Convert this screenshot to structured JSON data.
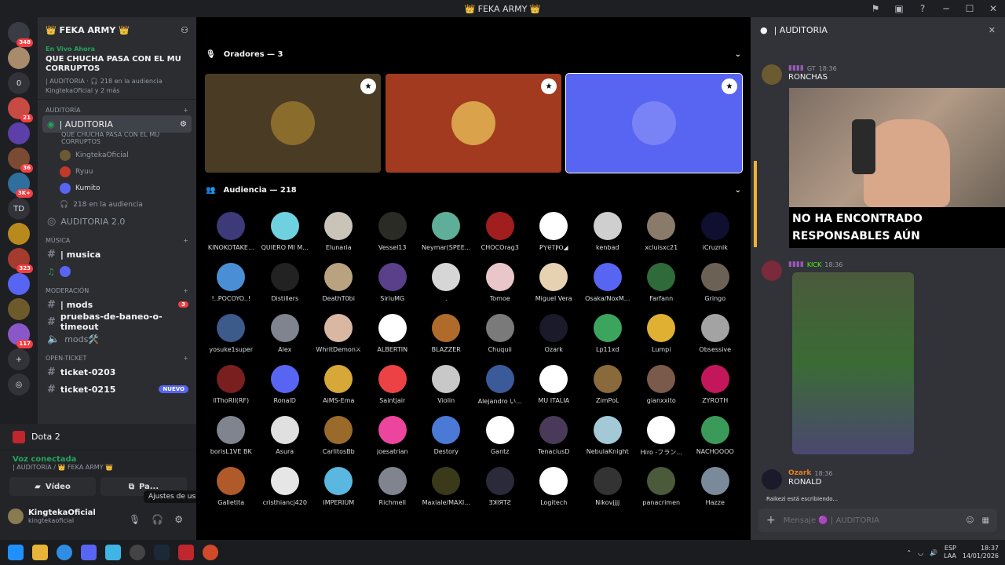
{
  "window": {
    "title": "👑 FEKA ARMY 👑"
  },
  "servers": [
    {
      "badge": "348",
      "color": "#3a3c43"
    },
    {
      "badge": "",
      "color": "#a88b6a"
    },
    {
      "badge": "",
      "color": "#313338",
      "text": "0"
    },
    {
      "badge": "21",
      "color": "#c74a43"
    },
    {
      "badge": "",
      "color": "#5c3fa8"
    },
    {
      "badge": "36",
      "color": "#7a4a33"
    },
    {
      "badge": "3K+",
      "color": "#2e6f9e"
    },
    {
      "badge": "",
      "color": "#313338",
      "text": "TD"
    },
    {
      "badge": "",
      "color": "#b88a1e"
    },
    {
      "badge": "323",
      "color": "#a33b2e"
    },
    {
      "badge": "",
      "color": "#5865f2"
    },
    {
      "badge": "",
      "color": "#6d5a2a"
    },
    {
      "badge": "117",
      "color": "#8a57c8"
    }
  ],
  "guild": {
    "name": "👑 FEKA ARMY 👑"
  },
  "live": {
    "tag": "En Vivo Ahora",
    "title": "QUE CHUCHA PASA CON EL MU CORRUPTOS",
    "meta1": "| AUDITORIA · 🎧 218 en la audiencia",
    "meta2": "KingtekaOficial y 2 más"
  },
  "categories": {
    "auditoria": "AUDITORÍA",
    "musica": "MÚSICA",
    "moderacion": "MODERACIÓN",
    "open_ticket": "OPEN-TICKET"
  },
  "channels": {
    "auditoria_active": "| AUDITORIA",
    "auditoria_sub": "QUE CHUCHA PASA CON EL MU CORRUPTOS",
    "members": [
      "KingtekaOficial",
      "Ryuu",
      "Kumito"
    ],
    "audience": "218 en la audiencia",
    "auditoria2": "AUDITORIA 2.0",
    "musica": "| musica",
    "mods": "| mods",
    "mods_badge": "3",
    "pruebas": "pruebas-de-baneo-o-timeout",
    "mods_voice": "mods🛠️",
    "ticket1": "ticket-0203",
    "ticket2": "ticket-0215",
    "nuevo": "NUEVO"
  },
  "activity": {
    "game": "Dota 2"
  },
  "voice": {
    "status": "Voz conectada",
    "location": "| AUDITORIA / 👑 FEKA ARMY 👑",
    "video_label": "Vídeo",
    "screen_label": "Pa..."
  },
  "tooltip": "Ajustes de usuario",
  "user": {
    "name": "KingtekaOficial",
    "tag": "kingtekaoficial"
  },
  "stage": {
    "speakers_label": "Oradores — 3",
    "audience_label": "Audiencia — 218"
  },
  "speakers": [
    {
      "bg": "#4a3c24",
      "avatar": "#8a6d2c"
    },
    {
      "bg": "#a13a1f",
      "avatar": "#d9a24b"
    },
    {
      "bg": "#5865f2",
      "avatar": "#7983f5"
    }
  ],
  "audience": [
    {
      "name": "KINOKOTAKE...",
      "color": "#3d3a7a"
    },
    {
      "name": "QUIERO MI M...",
      "color": "#6fd1e0"
    },
    {
      "name": "Elunaria",
      "color": "#c9c3b8"
    },
    {
      "name": "Vessel13",
      "color": "#2b2b26"
    },
    {
      "name": "Neymar(SPEE...",
      "color": "#5fae9a"
    },
    {
      "name": "CHOCOrag3",
      "color": "#a01e1e"
    },
    {
      "name": "ꝐⲨⲈ̷ⲦⲢⲞ◢",
      "color": "#ffffff"
    },
    {
      "name": "kenbad",
      "color": "#cfcfcf"
    },
    {
      "name": "xcluisxc21",
      "color": "#8a7a6a"
    },
    {
      "name": "iCruznik",
      "color": "#0f1030"
    },
    {
      "name": "!..POCOYO..!",
      "color": "#4a8fd6"
    },
    {
      "name": "Distillers",
      "color": "#222222"
    },
    {
      "name": "DeathT0bi",
      "color": "#b9a27f"
    },
    {
      "name": "SiriuMG",
      "color": "#5a3f8a"
    },
    {
      "name": ".",
      "color": "#d6d6d6"
    },
    {
      "name": "Tomoe",
      "color": "#e9c6c9"
    },
    {
      "name": "Miguel Vera",
      "color": "#e6d2b0"
    },
    {
      "name": "Osaka/NoxM...",
      "color": "#5865f2"
    },
    {
      "name": "Farfann",
      "color": "#2e6a3a"
    },
    {
      "name": "Gringo",
      "color": "#6b6255"
    },
    {
      "name": "yosuke1super",
      "color": "#3c5a8a"
    },
    {
      "name": "Alex",
      "color": "#80848e"
    },
    {
      "name": "WhritDemon⚔",
      "color": "#d9b7a3"
    },
    {
      "name": "ALBERTIN",
      "color": "#ffffff"
    },
    {
      "name": "BLAZZER",
      "color": "#b06a2a"
    },
    {
      "name": "Chuquii",
      "color": "#7a7a7a"
    },
    {
      "name": "Ozark",
      "color": "#1a1a2a"
    },
    {
      "name": "Lp11xd",
      "color": "#3ba55d"
    },
    {
      "name": "Lumpi",
      "color": "#e0b032"
    },
    {
      "name": "Obsessive",
      "color": "#a3a3a3"
    },
    {
      "name": "llThoRll(RF)",
      "color": "#7a1f1f"
    },
    {
      "name": "RonalD",
      "color": "#5865f2"
    },
    {
      "name": "AiMS-Ema",
      "color": "#d6a837"
    },
    {
      "name": "Saintjair",
      "color": "#ed4245"
    },
    {
      "name": "Violin",
      "color": "#c8c8c8"
    },
    {
      "name": "Alejandro い...",
      "color": "#3a5a9a"
    },
    {
      "name": "MU ITALIA",
      "color": "#ffffff"
    },
    {
      "name": "ZimPoL",
      "color": "#8a6a3a"
    },
    {
      "name": "gianxxito",
      "color": "#7a5a4a"
    },
    {
      "name": "ZYROTH",
      "color": "#c2185b"
    },
    {
      "name": "borisL1VE BK",
      "color": "#80848e"
    },
    {
      "name": "Asura",
      "color": "#e0e0e0"
    },
    {
      "name": "CarlitosBb",
      "color": "#9a6a2a"
    },
    {
      "name": "joesatrian",
      "color": "#eb459e"
    },
    {
      "name": "Destory",
      "color": "#4a7ad6"
    },
    {
      "name": "Gantz",
      "color": "#ffffff"
    },
    {
      "name": "TenaciusD",
      "color": "#4a3a5a"
    },
    {
      "name": "NebulaKnight",
      "color": "#a3c8d6"
    },
    {
      "name": "Hiro -フラン...",
      "color": "#ffffff"
    },
    {
      "name": "NACHOOOO",
      "color": "#3a9a5a"
    },
    {
      "name": "Galletita",
      "color": "#b05a2a"
    },
    {
      "name": "cristhiancj420",
      "color": "#e6e6e6"
    },
    {
      "name": "IMPERIUM",
      "color": "#5ab8e0"
    },
    {
      "name": "Richmell",
      "color": "#80848e"
    },
    {
      "name": "Maxiale/MAXI...",
      "color": "#3a3a1a"
    },
    {
      "name": "ƎꓘIЯTƧ",
      "color": "#2a2a3a"
    },
    {
      "name": "Logitech",
      "color": "#ffffff"
    },
    {
      "name": "Nikovjjjj",
      "color": "#333333"
    },
    {
      "name": "panacrimen",
      "color": "#4a5a3a"
    },
    {
      "name": "Hazze",
      "color": "#7a8a9a"
    }
  ],
  "chat": {
    "title": "| AUDITORIA",
    "msg1": {
      "time": "18:36",
      "text": "RONCHAS",
      "tag": "GT"
    },
    "caption": "NO HA ENCONTRADO RESPONSABLES AÚN",
    "msg2": {
      "time": "18:36",
      "tag": "KICK"
    },
    "msg3": {
      "user": "Ozark",
      "time": "18:36",
      "text": "RONALD"
    },
    "typing": "Raikezi está escribiendo...",
    "placeholder": "Mensaje 🟣 | AUDITORIA"
  },
  "taskbar": {
    "lang1": "ESP",
    "lang2": "LAA",
    "time": "18:37",
    "date": "14/01/2026"
  },
  "colors": {
    "accent": "#5865f2",
    "green": "#23a55a",
    "red": "#f23f43"
  }
}
